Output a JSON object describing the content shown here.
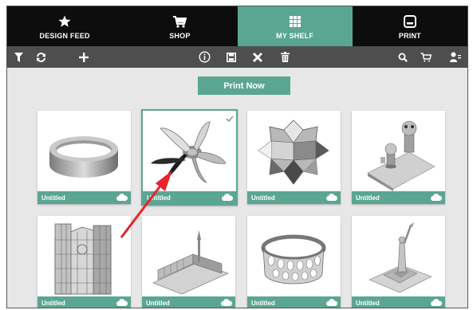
{
  "tabs": [
    {
      "label": "DESIGN FEED",
      "icon": "star-icon",
      "active": false
    },
    {
      "label": "SHOP",
      "icon": "cart-icon",
      "active": false
    },
    {
      "label": "MY SHELF",
      "icon": "grid-icon",
      "active": true
    },
    {
      "label": "PRINT",
      "icon": "printer-icon",
      "active": false
    }
  ],
  "toolbar": {
    "left": [
      "filter-icon",
      "refresh-icon",
      "add-icon"
    ],
    "center": [
      "info-icon",
      "save-icon",
      "close-icon",
      "trash-icon"
    ],
    "right": [
      "search-icon",
      "cart-icon",
      "user-icon"
    ]
  },
  "print_now_label": "Print Now",
  "cards": [
    {
      "title": "Untitled",
      "model": "ring",
      "selected": false
    },
    {
      "title": "Untitled",
      "model": "propeller",
      "selected": true
    },
    {
      "title": "Untitled",
      "model": "polyhedron",
      "selected": false
    },
    {
      "title": "Untitled",
      "model": "garden-figures",
      "selected": false
    },
    {
      "title": "Untitled",
      "model": "cathedral-front",
      "selected": false
    },
    {
      "title": "Untitled",
      "model": "cathedral-side",
      "selected": false
    },
    {
      "title": "Untitled",
      "model": "lattice-bracelet",
      "selected": false
    },
    {
      "title": "Untitled",
      "model": "statue-of-liberty",
      "selected": false
    }
  ],
  "colors": {
    "accent": "#5aa693",
    "tab_bar": "#0d0d0d",
    "toolbar": "#4e4e4e",
    "background": "#e7e7e7",
    "annotation_arrow": "#e8232a"
  }
}
